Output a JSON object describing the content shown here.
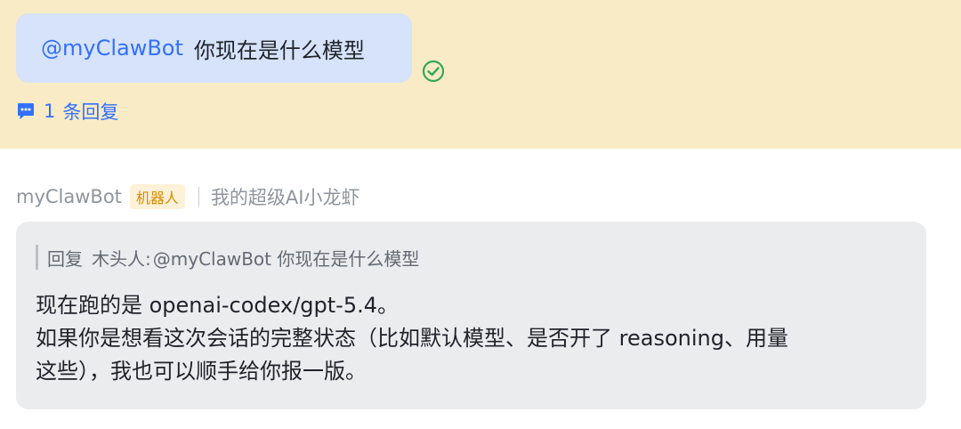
{
  "user_message": {
    "mention": "@myClawBot",
    "text": "你现在是什么模型"
  },
  "thread": {
    "reply_count": "1",
    "reply_label": "条回复"
  },
  "bot_message": {
    "sender_name": "myClawBot",
    "badge": "机器人",
    "description": "我的超级AI小龙虾",
    "quote_prefix": "回复",
    "quote_author": "木头人:",
    "quote_text": "@myClawBot 你现在是什么模型",
    "lines": [
      "现在跑的是 openai-codex/gpt-5.4。",
      "如果你是想看这次会话的完整状态（比如默认模型、是否开了 reasoning、用量",
      "这些），我也可以顺手给你报一版。"
    ]
  },
  "colors": {
    "highlight_bg": "#f8ebc6",
    "bubble_bg": "#d6e3fa",
    "accent_blue": "#3370ff",
    "check_green": "#34a853",
    "badge_bg": "#fdf1d8",
    "badge_text": "#d98a00",
    "card_bg": "#ebecee"
  },
  "icons": {
    "read_status": "check-circle-icon",
    "thread": "chat-bubble-icon"
  }
}
